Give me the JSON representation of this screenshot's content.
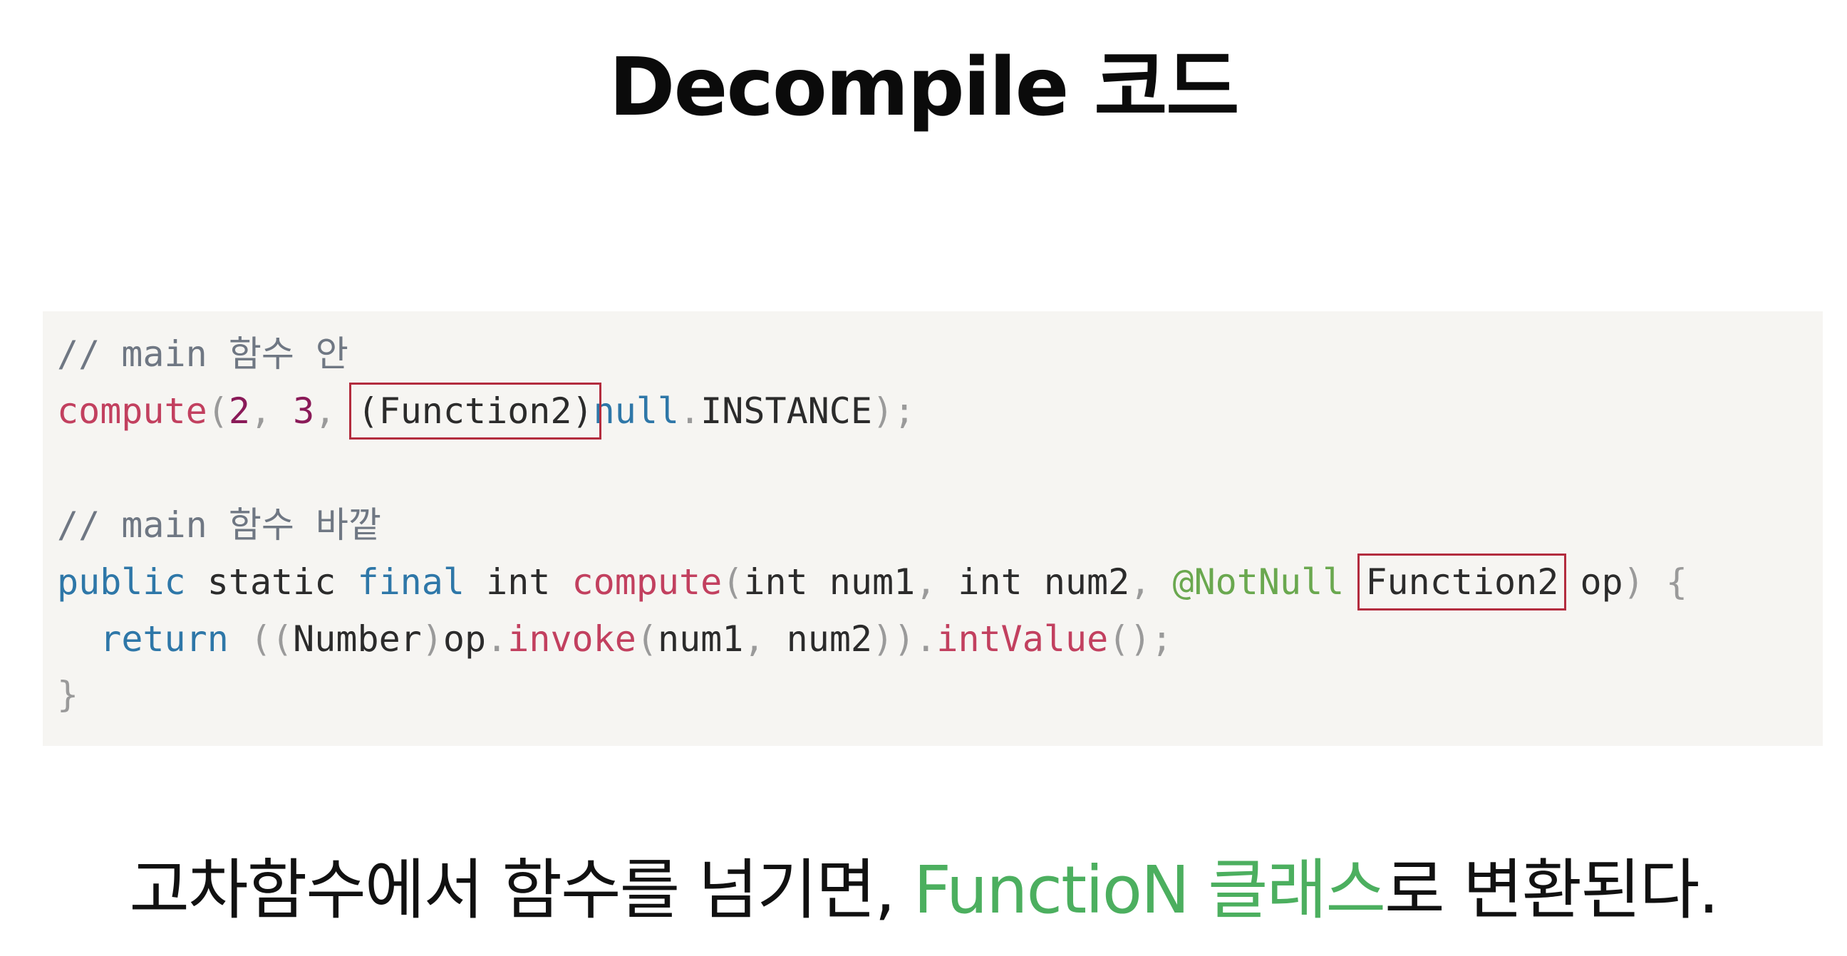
{
  "title": "Decompile 코드",
  "code": {
    "comment_inside": "// main 함수 안",
    "comment_outside": "// main 함수 바깥",
    "l2": {
      "fn": "compute",
      "p1": "(",
      "n2": "2",
      "c1": ", ",
      "n3": "3",
      "c2": ", ",
      "cast": "(Function2)",
      "null_kw": "null",
      "dot": ".",
      "instance": "INSTANCE",
      "end": ");"
    },
    "l5": {
      "public": "public",
      "static": "static",
      "final": "final",
      "int": "int",
      "fn": "compute",
      "p1": "(",
      "int1": "int",
      "num1": "num1",
      "c1": ", ",
      "int2": "int",
      "num2": "num2",
      "c2": ", ",
      "anno": "@NotNull",
      "type": "Function2",
      "op": "op",
      "p2": ")",
      "brace": "{"
    },
    "l6": {
      "return": "return",
      "p1": "((",
      "number": "Number",
      "p2": ")",
      "op": "op",
      "d1": ".",
      "invoke": "invoke",
      "p3": "(",
      "num1": "num1",
      "c1": ", ",
      "num2": "num2",
      "p4": "))",
      "d2": ".",
      "intvalue": "intValue",
      "end": "();"
    },
    "l7": "}"
  },
  "caption": {
    "pre": "고차함수에서 함수를 넘기면, ",
    "accent": "FunctioN 클래스",
    "post": "로 변환된다."
  },
  "colors": {
    "comment": "#6f7783",
    "function": "#c2405f",
    "number": "#8a1a58",
    "keyword": "#2e77a8",
    "annotation": "#6aa84f",
    "highlight_box": "#b32c3e",
    "caption_accent": "#4caf5f",
    "code_background": "#f6f5f2"
  }
}
